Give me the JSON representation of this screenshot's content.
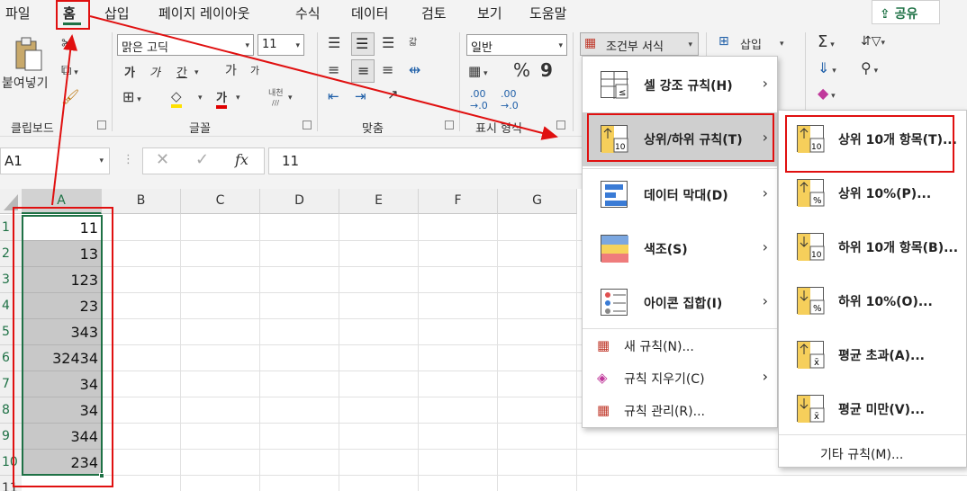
{
  "menu_tabs": [
    "파일",
    "홈",
    "삽입",
    "페이지 레이아웃",
    "수식",
    "데이터",
    "검토",
    "보기",
    "도움말"
  ],
  "share_label": "공유",
  "ribbon": {
    "clipboard": {
      "paste_label": "붙여넣기",
      "group_label": "클립보드"
    },
    "font": {
      "font_name": "맑은 고딕",
      "font_size": "11",
      "group_label": "글꼴",
      "bold": "가",
      "italic": "가",
      "underline": "간",
      "grow": "가",
      "shrink": "가",
      "color": "가",
      "phonetic_top": "내천",
      "phonetic_bottom": "/// "
    },
    "alignment": {
      "group_label": "맞춤",
      "wrap_label": "갋"
    },
    "number": {
      "format": "일반",
      "group_label": "표시 형식",
      "percent": "%",
      "comma": "9"
    },
    "styles": {
      "conditional_label": "조건부 서식"
    },
    "cells": {
      "insert_label": "삽입"
    }
  },
  "formula_bar": {
    "name_box": "A1",
    "fx": "fx",
    "formula": "11"
  },
  "columns": [
    "A",
    "B",
    "C",
    "D",
    "E",
    "F",
    "G"
  ],
  "rows": [
    "1",
    "2",
    "3",
    "4",
    "5",
    "6",
    "7",
    "8",
    "9",
    "10",
    "11"
  ],
  "cells_a": [
    "11",
    "13",
    "123",
    "23",
    "343",
    "32434",
    "34",
    "34",
    "344",
    "234"
  ],
  "cf_menu": {
    "items": [
      {
        "label": "셀 강조 규칙(H)",
        "icon": "highlight-rules-icon"
      },
      {
        "label": "상위/하위 규칙(T)",
        "icon": "top-bottom-rules-icon"
      },
      {
        "label": "데이터 막대(D)",
        "icon": "data-bars-icon"
      },
      {
        "label": "색조(S)",
        "icon": "color-scales-icon"
      },
      {
        "label": "아이콘 집합(I)",
        "icon": "icon-sets-icon"
      }
    ],
    "small_items": [
      "새 규칙(N)...",
      "규칙 지우기(C)",
      "규칙 관리(R)..."
    ]
  },
  "sub_menu": {
    "items": [
      "상위 10개 항목(T)...",
      "상위 10%(P)...",
      "하위 10개 항목(B)...",
      "하위 10%(O)...",
      "평균 초과(A)...",
      "평균 미만(V)..."
    ],
    "icon_marks": [
      "10",
      "%",
      "10",
      "%",
      "x̄",
      "x̄"
    ],
    "more_rules": "기타 규칙(M)..."
  },
  "colors": {
    "accent": "#1e7145",
    "annotation": "#e01010",
    "selection": "#c8c8c8"
  }
}
